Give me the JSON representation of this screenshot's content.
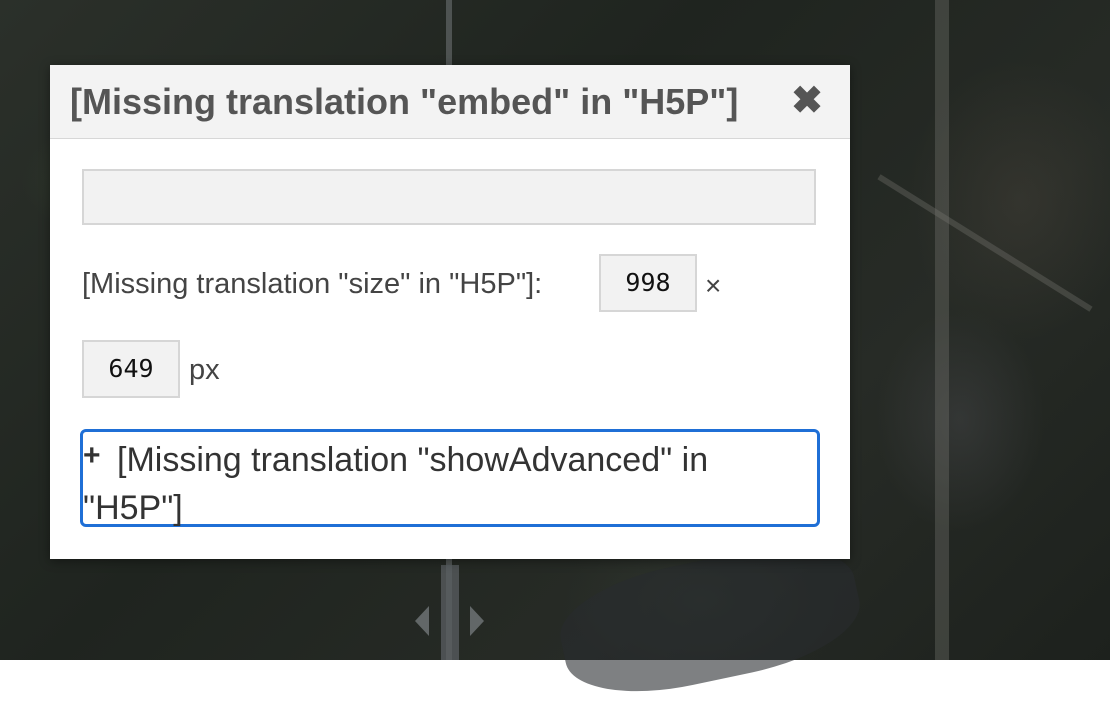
{
  "dialog": {
    "title": "[Missing translation \"embed\" in \"H5P\"]",
    "close_icon": "close-icon",
    "embed_code_value": "",
    "size_label": "[Missing translation \"size\" in \"H5P\"]:",
    "width_value": "998",
    "times_symbol": "×",
    "height_value": "649",
    "unit": "px",
    "advanced": {
      "icon": "plus-icon",
      "plus_symbol": "+",
      "label": "[Missing translation \"showAdvanced\" in \"H5P\"]"
    }
  },
  "background": {
    "divider_handle_icons": [
      "chevron-left-icon",
      "chevron-right-icon"
    ]
  },
  "colors": {
    "focus_outline": "#1f6fd6",
    "header_background": "#f3f3f3",
    "title_text": "#555555"
  }
}
